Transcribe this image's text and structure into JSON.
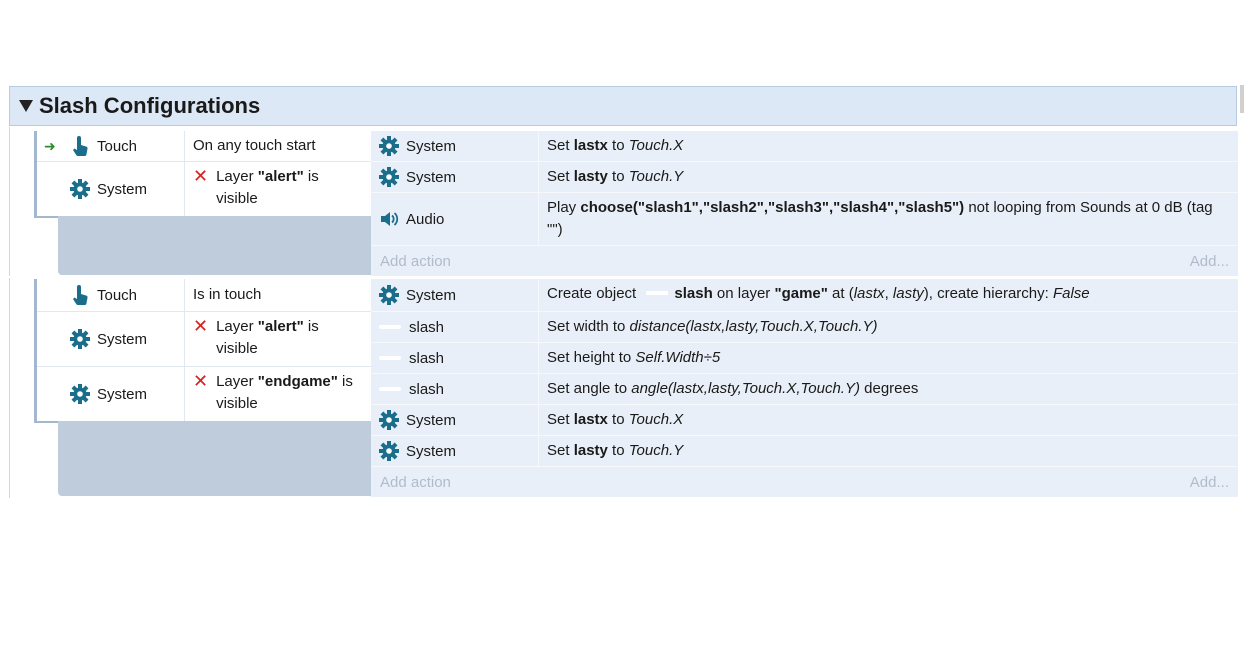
{
  "group": {
    "title": "Slash Configurations"
  },
  "event1": {
    "conditions": [
      {
        "object": "Touch",
        "text": "On any touch start"
      },
      {
        "object": "System",
        "prefix": "Layer ",
        "bold": "\"alert\"",
        "suffix": " is visible"
      }
    ],
    "actions": [
      {
        "object": "System",
        "t1": "Set ",
        "b1": "lastx",
        "t2": " to ",
        "i1": "Touch.X"
      },
      {
        "object": "System",
        "t1": "Set ",
        "b1": "lasty",
        "t2": " to ",
        "i1": "Touch.Y"
      },
      {
        "object": "Audio",
        "t1": "Play ",
        "b1": "choose(\"slash1\",\"slash2\",\"slash3\",\"slash4\",\"slash5\")",
        "t2": " not looping from Sounds at 0 dB (tag \"\")"
      }
    ],
    "add_action": "Add action",
    "add_more": "Add..."
  },
  "event2": {
    "conditions": [
      {
        "object": "Touch",
        "text": "Is in touch"
      },
      {
        "object": "System",
        "prefix": "Layer ",
        "bold": "\"alert\"",
        "suffix": " is visible"
      },
      {
        "object": "System",
        "prefix": "Layer ",
        "bold": "\"endgame\"",
        "suffix": " is visible"
      }
    ],
    "actions": [
      {
        "object": "System",
        "t1": "Create object ",
        "b1": "slash",
        "t2": " on layer ",
        "b2": "\"game\"",
        "t3": " at (",
        "i1": "lastx",
        "t4": ", ",
        "i2": "lasty",
        "t5": "), create hierarchy: ",
        "i3": "False"
      },
      {
        "object": "slash",
        "t1": "Set width to ",
        "i1": "distance(lastx,lasty,Touch.X,Touch.Y)"
      },
      {
        "object": "slash",
        "t1": "Set height to ",
        "i1": "Self.Width÷5"
      },
      {
        "object": "slash",
        "t1": "Set angle to ",
        "i1": "angle(lastx,lasty,Touch.X,Touch.Y)",
        "t2": " degrees"
      },
      {
        "object": "System",
        "t1": "Set ",
        "b1": "lastx",
        "t2": " to ",
        "i1": "Touch.X"
      },
      {
        "object": "System",
        "t1": "Set ",
        "b1": "lasty",
        "t2": " to ",
        "i1": "Touch.Y"
      }
    ],
    "add_action": "Add action",
    "add_more": "Add..."
  },
  "icons": {
    "touch": "touch-hand-icon",
    "system": "gear-icon",
    "audio": "speaker-icon",
    "invert": "red-x-icon",
    "trigger": "green-arrow-icon"
  },
  "colors": {
    "gear": "#1a6e8c",
    "header_bg": "#dce8f5",
    "action_bg": "#e9eff8",
    "invert": "#d61f1f"
  }
}
